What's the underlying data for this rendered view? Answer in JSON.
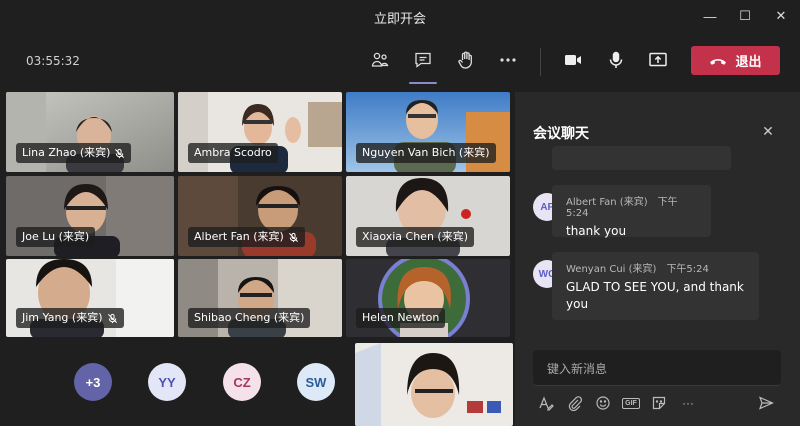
{
  "window": {
    "title": "立即开会",
    "minimize": "—",
    "maximize": "☐",
    "close": "✕"
  },
  "toolbar": {
    "timer": "03:55:32",
    "leave_label": "退出",
    "icons": [
      "participants-icon",
      "chat-icon",
      "raise-hand-icon",
      "more-icon",
      "camera-icon",
      "microphone-icon",
      "share-screen-icon",
      "phone-hangup-icon"
    ]
  },
  "participants": [
    {
      "name": "Lina Zhao (来宾)",
      "muted": true
    },
    {
      "name": "Ambra Scodro",
      "muted": false
    },
    {
      "name": "Nguyen Van Bich (来宾)",
      "muted": false
    },
    {
      "name": "Joe Lu (来宾)",
      "muted": false
    },
    {
      "name": "Albert Fan (来宾)",
      "muted": true
    },
    {
      "name": "Xiaoxia Chen (来宾)",
      "muted": false
    },
    {
      "name": "Jim Yang (来宾)",
      "muted": true
    },
    {
      "name": "Shibao Cheng (来宾)",
      "muted": false
    },
    {
      "name": "Helen Newton",
      "muted": false
    }
  ],
  "overflow_avatars": [
    {
      "label": "+3",
      "bg": "#6264a7",
      "fg": "#ffffff"
    },
    {
      "label": "YY",
      "bg": "#e3e6f7",
      "fg": "#4f52b2"
    },
    {
      "label": "CZ",
      "bg": "#f5e1ea",
      "fg": "#a4375a"
    },
    {
      "label": "SW",
      "bg": "#dde9f7",
      "fg": "#2a5c9c"
    }
  ],
  "chat": {
    "title": "会议聊天",
    "close": "✕",
    "messages": [
      {
        "initials": "AF",
        "author": "Albert Fan (来宾)",
        "time": "下午5:24",
        "text": "thank you"
      },
      {
        "initials": "WC",
        "author": "Wenyan Cui (来宾)",
        "time": "下午5:24",
        "text": "GLAD TO SEE YOU, and thank you"
      }
    ],
    "compose_placeholder": "键入新消息",
    "tools": [
      "format-icon",
      "attach-icon",
      "emoji-icon",
      "gif-icon",
      "sticker-icon",
      "more-options-icon",
      "send-icon"
    ],
    "gif_label": "GIF",
    "more_label": "···"
  },
  "colors": {
    "accent": "#6264a7",
    "leave": "#c4314b",
    "chat_bg": "#292929",
    "app_bg": "#1f1f1f"
  }
}
